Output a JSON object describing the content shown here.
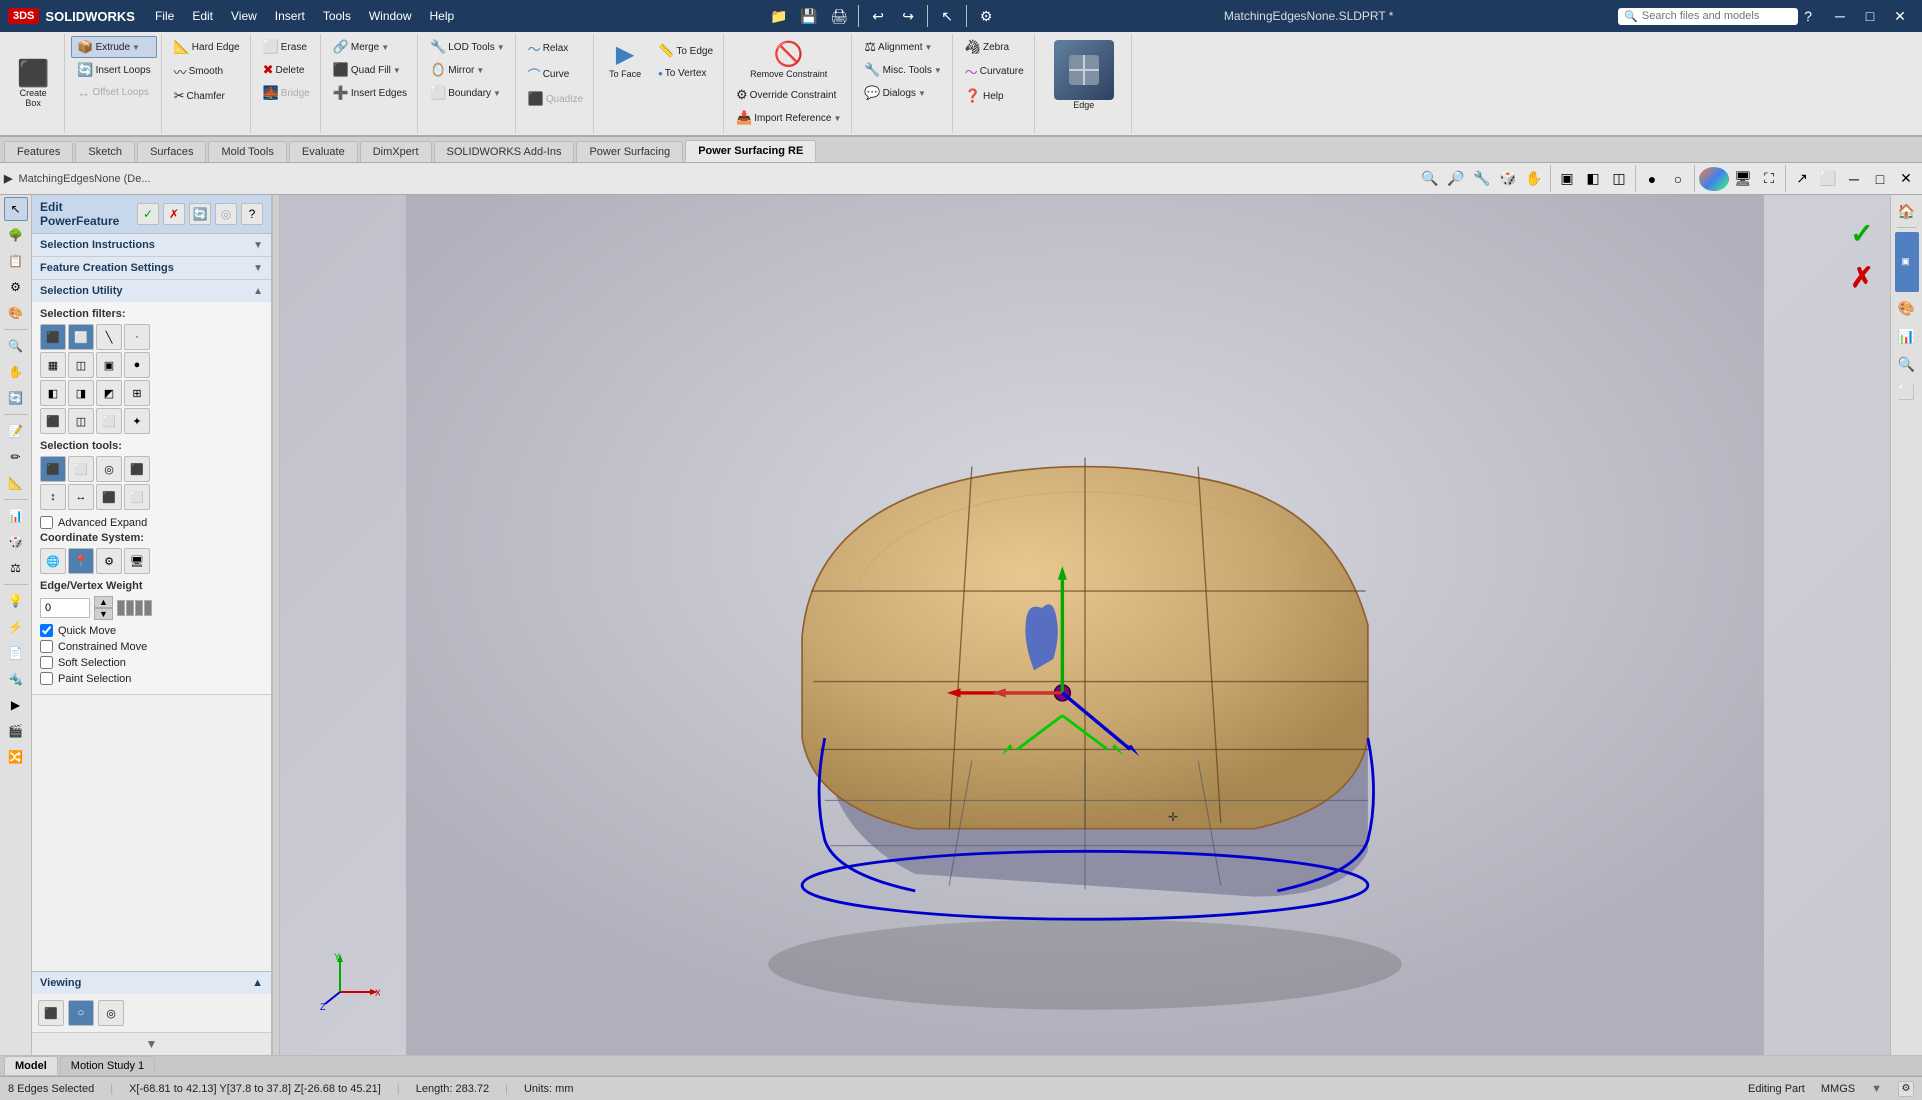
{
  "app": {
    "title": "SOLIDWORKS",
    "file": "MatchingEdgesNone.SLDPRT *",
    "search_placeholder": "Search files and models"
  },
  "menu": {
    "items": [
      "File",
      "Edit",
      "View",
      "Insert",
      "Tools",
      "Window",
      "Help"
    ]
  },
  "ribbon": {
    "groups": [
      {
        "name": "create",
        "buttons": [
          {
            "label": "Create Box",
            "icon": "⬛"
          },
          {
            "label": "Extrude",
            "icon": "📦"
          },
          {
            "label": "Insert Loops",
            "icon": "🔄"
          },
          {
            "label": "Offset Loops",
            "icon": "↔"
          }
        ]
      },
      {
        "name": "edit",
        "buttons": [
          {
            "label": "Hard Edge",
            "icon": "📐"
          },
          {
            "label": "Smooth",
            "icon": "〰"
          },
          {
            "label": "Chamfer",
            "icon": "✂"
          }
        ]
      },
      {
        "name": "delete",
        "buttons": [
          {
            "label": "Erase",
            "icon": "⬜"
          },
          {
            "label": "Delete",
            "icon": "✖"
          },
          {
            "label": "Bridge",
            "icon": "🌉"
          }
        ]
      },
      {
        "name": "fill",
        "buttons": [
          {
            "label": "Merge",
            "icon": "🔗"
          },
          {
            "label": "Quad Fill",
            "icon": "⬛"
          },
          {
            "label": "Insert Edges",
            "icon": "➕"
          }
        ]
      },
      {
        "name": "lod",
        "buttons": [
          {
            "label": "LOD Tools",
            "icon": "🔧"
          },
          {
            "label": "Mirror",
            "icon": "🪞"
          },
          {
            "label": "Boundary",
            "icon": "⬜"
          }
        ]
      },
      {
        "name": "relax",
        "buttons": [
          {
            "label": "Relax",
            "icon": "〜"
          },
          {
            "label": "Curve",
            "icon": "⌒"
          },
          {
            "label": "Quadize",
            "icon": "⬛"
          }
        ]
      },
      {
        "name": "face",
        "buttons": [
          {
            "label": "To Face",
            "icon": "▶"
          },
          {
            "label": "To Edge",
            "icon": "📏"
          },
          {
            "label": "To Vertex",
            "icon": "•"
          }
        ]
      },
      {
        "name": "constraint",
        "buttons": [
          {
            "label": "Remove Constraint",
            "icon": "🚫"
          },
          {
            "label": "Override Constraint",
            "icon": "⚙"
          },
          {
            "label": "Import Reference",
            "icon": "📥"
          }
        ]
      },
      {
        "name": "alignment",
        "buttons": [
          {
            "label": "Alignment",
            "icon": "⚖"
          },
          {
            "label": "Misc. Tools",
            "icon": "🔧"
          },
          {
            "label": "Dialogs",
            "icon": "💬"
          }
        ]
      },
      {
        "name": "zebra",
        "buttons": [
          {
            "label": "Zebra",
            "icon": "🦓"
          },
          {
            "label": "Curvature",
            "icon": "〜"
          },
          {
            "label": "Help",
            "icon": "❓"
          }
        ]
      }
    ]
  },
  "tabs": {
    "items": [
      "Features",
      "Sketch",
      "Surfaces",
      "Mold Tools",
      "Evaluate",
      "DimXpert",
      "SOLIDWORKS Add-Ins",
      "Power Surfacing",
      "Power Surfacing RE"
    ],
    "active": "Power Surfacing RE"
  },
  "left_panel": {
    "edit_header": "Edit PowerFeature",
    "sections": {
      "selection_instructions": {
        "label": "Selection Instructions",
        "expanded": false
      },
      "feature_creation": {
        "label": "Feature Creation Settings",
        "expanded": false
      },
      "selection_utility": {
        "label": "Selection Utility",
        "expanded": true,
        "filters_label": "Selection filters:",
        "tools_label": "Selection tools:",
        "coordinate_label": "Coordinate System:",
        "edge_weight_label": "Edge/Vertex Weight",
        "edge_weight_value": "0",
        "checkboxes": [
          {
            "label": "Advanced Expand",
            "checked": false
          },
          {
            "label": "Quick Move",
            "checked": true
          },
          {
            "label": "Constrained Move",
            "checked": false
          },
          {
            "label": "Soft Selection",
            "checked": false
          },
          {
            "label": "Paint Selection",
            "checked": false
          }
        ]
      }
    },
    "viewing": {
      "label": "Viewing",
      "expanded": true
    }
  },
  "viewport": {
    "breadcrumb": "MatchingEdgesNone (De..."
  },
  "bottom_tabs": {
    "items": [
      "Model",
      "Motion Study 1"
    ],
    "active": "Model"
  },
  "statusbar": {
    "selection": "8 Edges Selected",
    "coordinates": "X[-68.81 to 42.13]  Y[37.8 to 37.8]  Z[-26.68 to 45.21]",
    "length": "Length: 283.72",
    "units": "Units: mm",
    "mode": "Editing Part",
    "unit_system": "MMGS"
  },
  "icons": {
    "check": "✓",
    "cross": "✗",
    "arrow_down": "▼",
    "arrow_up": "▲",
    "arrow_right": "▶",
    "question": "?",
    "expand": "▸",
    "collapse": "▾"
  }
}
